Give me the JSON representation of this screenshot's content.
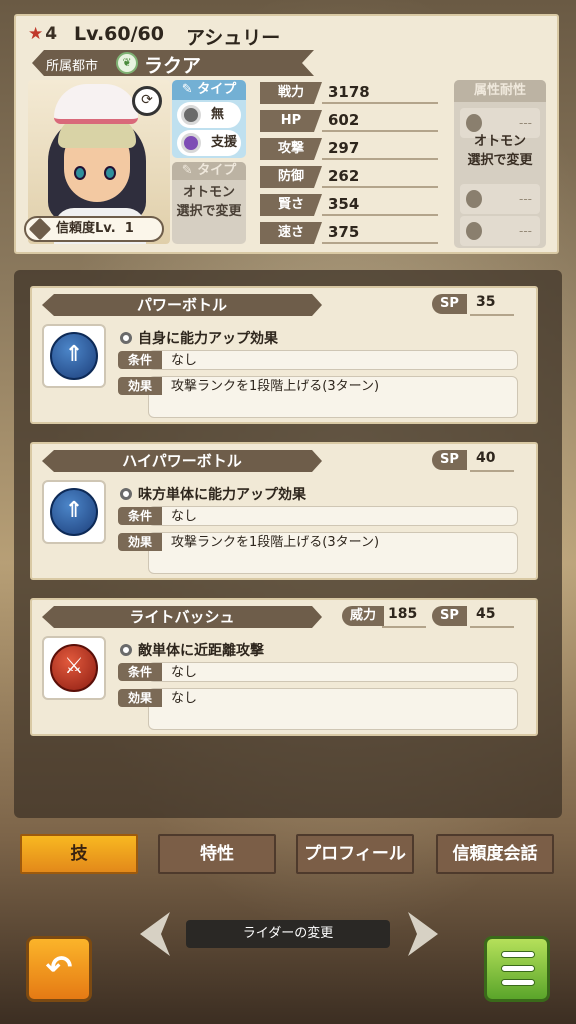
{
  "header": {
    "rarity_icon": "star-icon",
    "rarity": "4",
    "level": "Lv.60/60",
    "name": "アシュリー"
  },
  "city": {
    "label": "所属都市",
    "icon": "leaf-crest-icon",
    "name": "ラクア"
  },
  "portrait": {
    "trust_label": "信頼度Lv.",
    "trust_value": "1"
  },
  "type": {
    "header": "タイプ",
    "items": [
      "無",
      "支援"
    ],
    "header2": "タイプ",
    "note": [
      "オトモン",
      "選択で変更"
    ],
    "dash": "---"
  },
  "stats": [
    {
      "label": "戦力",
      "value": "3178"
    },
    {
      "label": "HP",
      "value": "602"
    },
    {
      "label": "攻撃",
      "value": "297"
    },
    {
      "label": "防御",
      "value": "262"
    },
    {
      "label": "賢さ",
      "value": "354"
    },
    {
      "label": "速さ",
      "value": "375"
    }
  ],
  "resist": {
    "header": "属性耐性",
    "note": [
      "オトモン",
      "選択で変更"
    ],
    "dash": "---"
  },
  "skills": [
    {
      "name": "パワーボトル",
      "sp_label": "SP",
      "sp": "35",
      "icon": "power-bottle-icon",
      "desc": "自身に能力アップ効果",
      "cond_label": "条件",
      "cond": "なし",
      "eff_label": "効果",
      "eff": "攻撃ランクを1段階上げる(3ターン)"
    },
    {
      "name": "ハイパワーボトル",
      "sp_label": "SP",
      "sp": "40",
      "icon": "power-bottle-icon",
      "desc": "味方単体に能力アップ効果",
      "cond_label": "条件",
      "cond": "なし",
      "eff_label": "効果",
      "eff": "攻撃ランクを1段階上げる(3ターン)"
    },
    {
      "name": "ライトバッシュ",
      "power_label": "威力",
      "power": "185",
      "sp_label": "SP",
      "sp": "45",
      "icon": "sword-icon",
      "desc": "敵単体に近距離攻撃",
      "cond_label": "条件",
      "cond": "なし",
      "eff_label": "効果",
      "eff": "なし"
    }
  ],
  "tabs": [
    "技",
    "特性",
    "プロフィール",
    "信頼度会話"
  ],
  "footer": {
    "rider_change": "ライダーの変更"
  },
  "colors": {
    "active_tab": "#f8b821",
    "panel": "#f1e9d6",
    "label_brown": "#7b6a56",
    "menu_green": "#5aa52a"
  }
}
